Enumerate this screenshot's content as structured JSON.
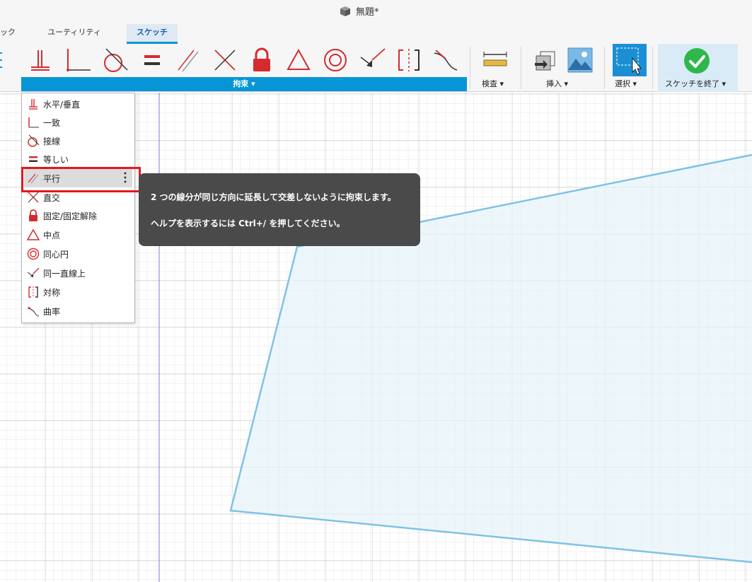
{
  "window": {
    "title": "無題*"
  },
  "tabs": [
    {
      "label": "ック"
    },
    {
      "label": "ユーティリティ"
    },
    {
      "label": "スケッチ"
    }
  ],
  "toolbar": {
    "constraint_label": "拘束 ▾",
    "inspect_label": "検査 ▾",
    "insert_label": "挿入 ▾",
    "select_label": "選択 ▾",
    "finish_label": "スケッチを終了 ▾"
  },
  "menu": {
    "items": [
      {
        "label": "水平/垂直",
        "icon": "horizontal-vertical-icon"
      },
      {
        "label": "一致",
        "icon": "coincident-icon"
      },
      {
        "label": "接線",
        "icon": "tangent-icon"
      },
      {
        "label": "等しい",
        "icon": "equal-icon"
      },
      {
        "label": "平行",
        "icon": "parallel-icon"
      },
      {
        "label": "直交",
        "icon": "perpendicular-icon"
      },
      {
        "label": "固定/固定解除",
        "icon": "lock-icon"
      },
      {
        "label": "中点",
        "icon": "midpoint-icon"
      },
      {
        "label": "同心円",
        "icon": "concentric-icon"
      },
      {
        "label": "同一直線上",
        "icon": "collinear-icon"
      },
      {
        "label": "対称",
        "icon": "symmetry-icon"
      },
      {
        "label": "曲率",
        "icon": "curvature-icon"
      }
    ]
  },
  "tooltip": {
    "line1": "2 つの線分が同じ方向に延長して交差しないように拘束します。",
    "line2": "ヘルプを表示するには Ctrl+/ を押してください。"
  },
  "colors": {
    "accent": "#0696d7",
    "constraint_red": "#d52b2f",
    "highlight_red": "#e0191e",
    "sketch_line": "#7fc2e6",
    "sketch_fill": "#e6f3fa",
    "finish_green": "#2eb84b"
  }
}
